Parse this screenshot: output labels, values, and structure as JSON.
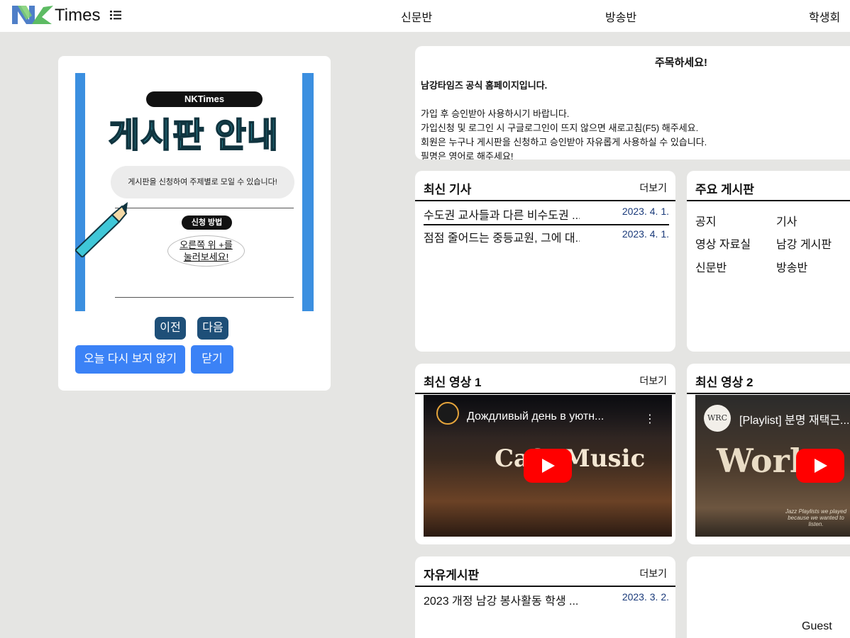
{
  "header": {
    "logo_text": "Times",
    "nav": [
      "신문반",
      "방송반",
      "학생회"
    ]
  },
  "popup": {
    "poster": {
      "brand": "NKTimes",
      "title": "게시판 안내",
      "bubble": "게시판을 신청하여 주제별로 모일 수 있습니다!",
      "method_label": "신청 방법",
      "instruction_line1": "오른쪽 위 +를",
      "instruction_line2": "눌러보세요!"
    },
    "prev_label": "이전",
    "next_label": "다음",
    "hide_today_label": "오늘 다시 보지 않기",
    "close_label": "닫기"
  },
  "notice": {
    "title": "주목하세요!",
    "headline": "남강타임즈 공식 홈페이지입니다.",
    "lines": [
      "가입 후 승인받아 사용하시기 바랍니다.",
      "가입신청 및 로그인 시 구글로그인이 뜨지 않으면 새로고침(F5) 해주세요.",
      "회원은 누구나 게시판을 신청하고 승인받아 자유롭게 사용하실 수 있습니다.",
      "필명은 영어로 해주세요!"
    ]
  },
  "latest_articles": {
    "title": "최신 기사",
    "more": "더보기",
    "items": [
      {
        "title": "수도권 교사들과 다른 비수도권 ...",
        "date": "2023. 4. 1."
      },
      {
        "title": "점점 줄어드는 중등교원, 그에 대...",
        "date": "2023. 4. 1."
      }
    ]
  },
  "main_boards": {
    "title": "주요 게시판",
    "links": [
      "공지",
      "기사",
      "영상 자료실",
      "남강 게시판",
      "신문반",
      "방송반"
    ]
  },
  "video1": {
    "title": "최신 영상 1",
    "more": "더보기",
    "video_title": "Дождливый день в уютн...",
    "overlay_text": "Cafe Music"
  },
  "video2": {
    "title": "최신 영상 2",
    "video_title": "[Playlist] 분명 재택근...",
    "channel": "WRC",
    "overlay_text": "Work",
    "caption": "Jazz Playlists we played because we wanted to listen."
  },
  "free_board": {
    "title": "자유게시판",
    "more": "더보기",
    "items": [
      {
        "title": "2023 개정 남강 봉사활동 학생 ...",
        "date": "2023. 3. 2."
      }
    ]
  },
  "user": {
    "name": "Guest"
  },
  "colors": {
    "background": "#e5e5e3",
    "nav_button": "#1e4f78",
    "primary_button": "#3b82f6",
    "date": "#1a3a7a",
    "poster_blue": "#3b8fe0"
  }
}
